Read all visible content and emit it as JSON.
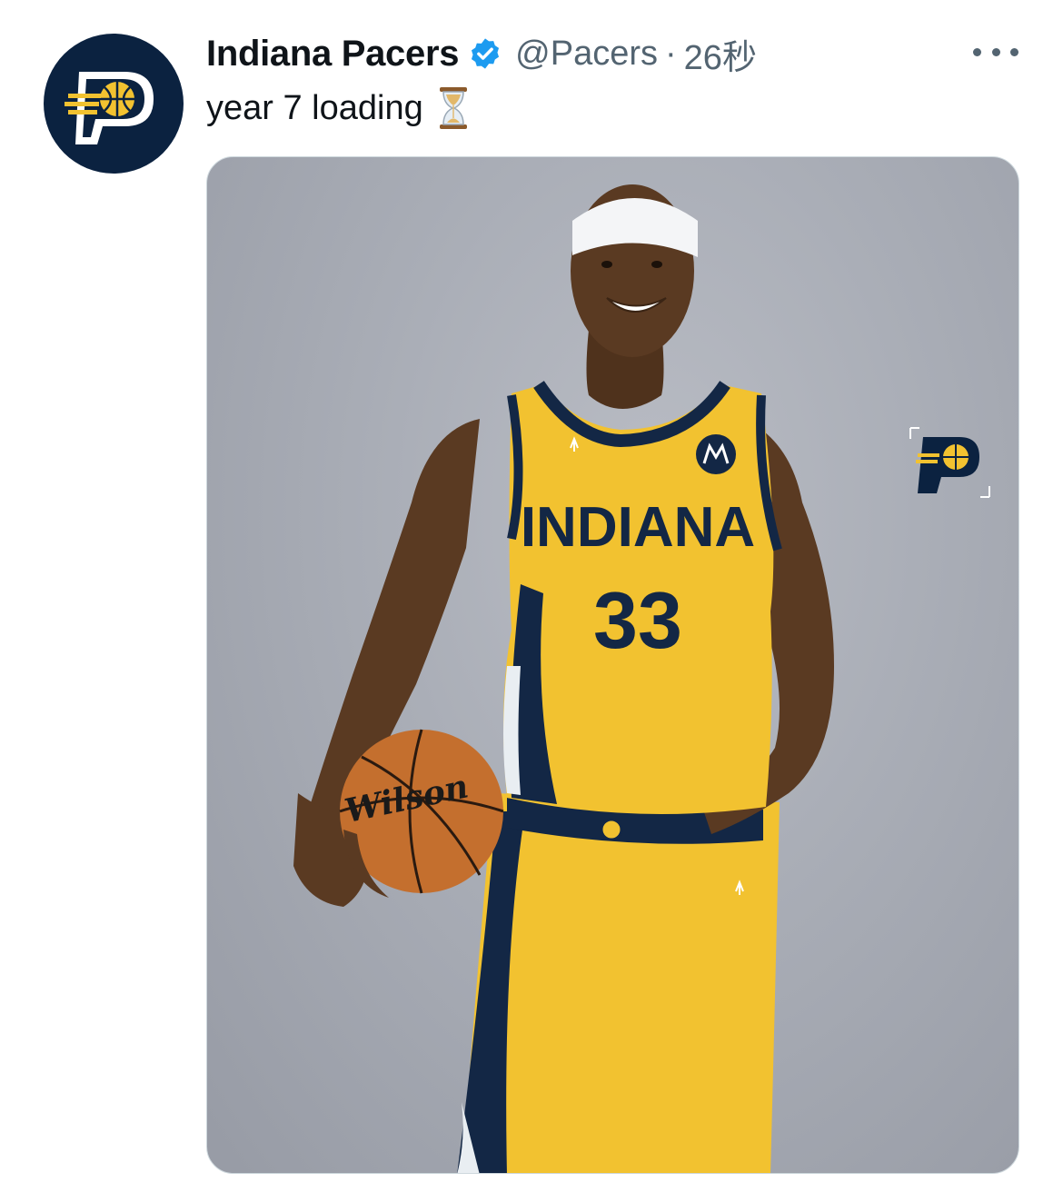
{
  "author": {
    "name": "Indiana Pacers",
    "handle": "@Pacers",
    "separator": "·",
    "timestamp": "26秒",
    "verified": true,
    "avatar_icon": "pacers-logo-icon"
  },
  "tweet": {
    "text": "year 7 loading",
    "emoji_icon": "hourglass-icon"
  },
  "menu": {
    "icon": "more-options-icon"
  },
  "media": {
    "jersey_team": "INDIANA",
    "jersey_number": "33",
    "ball_brand": "Wilson",
    "watermark_icon": "pacers-logo-icon"
  },
  "colors": {
    "navy": "#0b2240",
    "gold": "#f2c230",
    "verified_blue": "#1d9bf0",
    "secondary_text": "#536471"
  }
}
